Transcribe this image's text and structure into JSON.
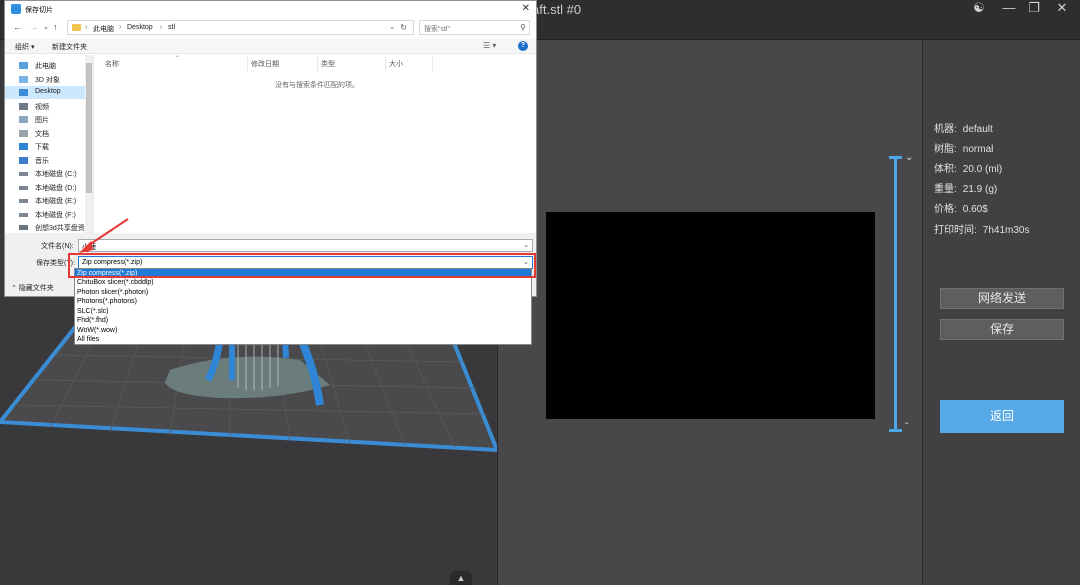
{
  "app": {
    "title": "aft.stl #0",
    "user_icon": "user-icon",
    "window_controls": [
      "minimize-icon",
      "restore-icon",
      "close-icon"
    ]
  },
  "info": {
    "machine_label": "机器:",
    "machine_value": "default",
    "resin_label": "树脂:",
    "resin_value": "normal",
    "volume_label": "体积:",
    "volume_value": "20.0  (ml)",
    "weight_label": "重量:",
    "weight_value": "21.9  (g)",
    "price_label": "价格:",
    "price_value": "0.60$",
    "print_time_label": "打印时间:",
    "print_time_value": "7h41m30s"
  },
  "buttons": {
    "network_send": "网络发送",
    "save": "保存",
    "return": "返回"
  },
  "dialog": {
    "title": "保存切片",
    "breadcrumbs": [
      "此电脑",
      "Desktop",
      "stl"
    ],
    "search_placeholder": "搜索\"stl\"",
    "toolbar": {
      "organize": "组织 ▾",
      "new_folder": "新建文件夹"
    },
    "nav_items": [
      {
        "label": "此电脑",
        "icon": "computer-icon"
      },
      {
        "label": "3D 对象",
        "icon": "cube-icon"
      },
      {
        "label": "Desktop",
        "icon": "desktop-icon",
        "selected": true
      },
      {
        "label": "视频",
        "icon": "video-icon"
      },
      {
        "label": "图片",
        "icon": "picture-icon"
      },
      {
        "label": "文档",
        "icon": "document-icon"
      },
      {
        "label": "下载",
        "icon": "download-icon"
      },
      {
        "label": "音乐",
        "icon": "music-icon"
      },
      {
        "label": "本地磁盘 (C:)",
        "icon": "drive-icon"
      },
      {
        "label": "本地磁盘 (D:)",
        "icon": "drive-icon"
      },
      {
        "label": "本地磁盘 (E:)",
        "icon": "drive-icon"
      },
      {
        "label": "本地磁盘 (F:)",
        "icon": "drive-icon"
      },
      {
        "label": "创想3d共享盘资",
        "icon": "network-drive-icon"
      }
    ],
    "columns": [
      "名称",
      "修改日期",
      "类型",
      "大小"
    ],
    "empty_message": "没有与搜索条件匹配的项。",
    "filename_label": "文件名(N):",
    "filename_value": "小鹿",
    "filetype_label": "保存类型(T):",
    "filetype_value": "Zip compress(*.zip)",
    "file_type_options": [
      "Zip compress(*.zip)",
      "ChituBox slicer(*.cbddlp)",
      "Photon slicer(*.photon)",
      "Photons(*.photons)",
      "SLC(*.slc)",
      "Fhd(*.fhd)",
      "WoW(*.wow)",
      "All files"
    ],
    "hide_folders": "隐藏文件夹"
  },
  "colors": {
    "accent_blue": "#56a9e6",
    "model_blue": "#2f86d6",
    "highlight_red": "#e53935"
  }
}
